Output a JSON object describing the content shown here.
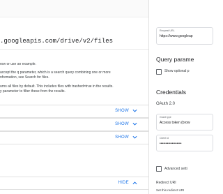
{
  "request": {
    "url": ".googleapis.com/drive/v2/files"
  },
  "description": [
    "row or use an example.",
    "accept the q parameter, which is a search query combining one or more",
    "nformation, see Search for files.",
    "urns all files by default. This includes files with trashed=true in the results.",
    "y parameter to filter these from the results."
  ],
  "sections": [
    {
      "label": "SHOW"
    },
    {
      "label": "SHOW"
    },
    {
      "label": "SHOW"
    },
    {
      "label": "HIDE"
    }
  ],
  "panel": {
    "request_url": {
      "label": "Request URL",
      "value": "https://www.googleap"
    },
    "query_params_title": "Query parame",
    "show_optional_label": "Show optional p",
    "credentials_title": "Credentials",
    "oauth_label": "OAuth 2.0",
    "grant_type": {
      "label": "Grant type",
      "value": "Access token (brow"
    },
    "client_id": {
      "label": "Client id",
      "value": "••••••••••••••••••"
    },
    "advanced_label": "Advanced setti",
    "redirect_title": "Redirect URI",
    "redirect_text": "Set this redirect URI"
  }
}
